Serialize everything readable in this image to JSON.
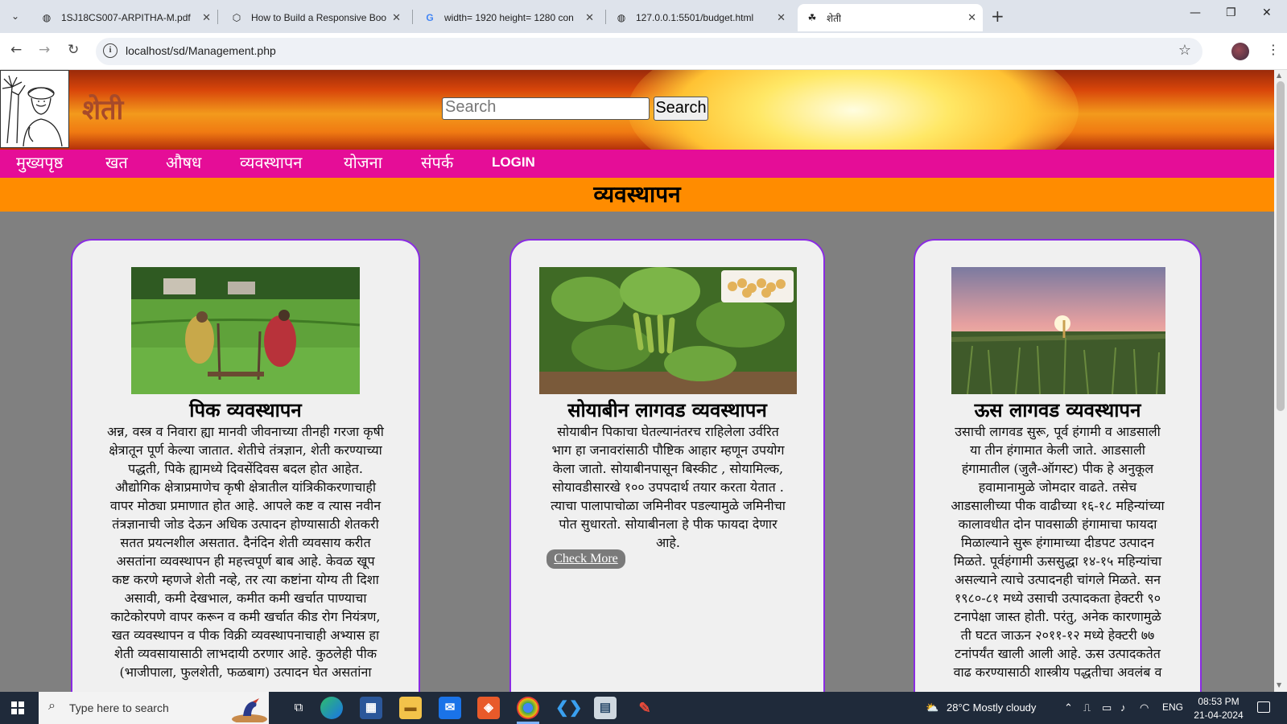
{
  "browser": {
    "tabs": [
      {
        "title": "1SJ18CS007-ARPITHA-M.pdf",
        "icon": "globe-icon"
      },
      {
        "title": "How to Build a Responsive Boo",
        "icon": "codepen-icon"
      },
      {
        "title": "width= 1920 height= 1280 con",
        "icon": "google-icon"
      },
      {
        "title": "127.0.0.1:5501/budget.html",
        "icon": "globe-icon"
      },
      {
        "title": "शेती",
        "icon": "farmer-favicon"
      }
    ],
    "url": "localhost/sd/Management.php"
  },
  "site": {
    "title": "शेती",
    "search_placeholder": "Search",
    "search_button": "Search",
    "nav": [
      "मुख्यपृष्ठ",
      "खत",
      "औषध",
      "व्यवस्थापन",
      "योजना",
      "संपर्क",
      "LOGIN"
    ],
    "section_heading": "व्यवस्थापन"
  },
  "cards": [
    {
      "title": "पिक व्यवस्थापन",
      "lines": [
        "अन्न, वस्त्र व निवारा ह्या मानवी जीवनाच्या तीनही गरजा कृषी",
        "क्षेत्रातून पूर्ण केल्या जातात. शेतीचे तंत्रज्ञान, शेती करण्याच्या",
        "पद्धती, पिके ह्यामध्ये दिवसेंदिवस बदल होत आहेत.",
        "औद्योगिक क्षेत्राप्रमाणेच कृषी क्षेत्रातील यांत्रिकीकरणाचाही",
        "वापर मोठ्या प्रमाणात होत आहे. आपले कष्ट व त्यास नवीन",
        "तंत्रज्ञानाची जोड देऊन अधिक उत्पादन होण्यासाठी शेतकरी",
        "सतत प्रयत्नशील असतात. दैनंदिन शेती व्यवसाय करीत",
        "असतांना व्यवस्थापन ही महत्त्वपूर्ण बाब आहे. केवळ खूप",
        "कष्ट करणे म्हणजे शेती नव्हे, तर त्या कष्टांना योग्य ती दिशा",
        "असावी, कमी देखभाल, कमीत कमी खर्चात पाण्याचा",
        "काटेकोरपणे वापर करून व कमी खर्चात कीड रोग नियंत्रण,",
        "खत व्यवस्थापन व पीक विक्री व्यवस्थापनाचाही अभ्यास हा",
        "शेती व्यवसायासाठी लाभदायी ठरणार आहे. कुठलेही पीक",
        "(भाजीपाला, फुलशेती, फळबाग) उत्पादन घेत असतांना"
      ]
    },
    {
      "title": "सोयाबीन लागवड व्यवस्थापन",
      "lines": [
        "सोयाबीन पिकाचा घेतल्यानंतरच राहिलेला उर्वरित",
        "भाग हा जनावरांसाठी पौष्टिक आहार म्हणून उपयोग",
        "केला जातो. सोयाबीनपासून बिस्कीट , सोयामिल्क,",
        "सोयावडीसारखे १०० उपपदार्थ तयार करता येतात .",
        "त्याचा पालापाचोळा जमिनीवर पडल्यामुळे जमिनीचा",
        "पोत सुधारतो. सोयाबीनला हे पीक फायदा देणार",
        "आहे."
      ],
      "button": "Check More"
    },
    {
      "title": "ऊस लागवड व्यवस्थापन",
      "lines": [
        "उसाची लागवड सुरू, पूर्व हंगामी व आडसाली",
        "या तीन हंगामात केली जाते. आडसाली",
        "हंगामातील (जुलै-ऑगस्ट) पीक हे अनुकूल",
        "हवामानामुळे जोमदार वाढते. तसेच",
        "आडसालीच्या पीक वाढीच्या १६-१८ महिन्यांच्या",
        "कालावधीत दोन पावसाळी हंगामाचा फायदा",
        "मिळाल्याने सुरू हंगामाच्या दीडपट उत्पादन",
        "मिळते. पूर्वहंगामी ऊससुद्धा १४-१५ महिन्यांचा",
        "असल्याने त्याचे उत्पादनही चांगले मिळते. सन",
        "१९८०-८१ मध्ये उसाची उत्पादकता हेक्टरी ९०",
        "टनापेक्षा जास्त होती. परंतु, अनेक कारणामुळे",
        "ती घटत जाऊन २०११-१२ मध्ये हेक्टरी ७७",
        "टनांपर्यंत खाली आली आहे. ऊस उत्पादकतेत",
        "वाढ करण्यासाठी शास्त्रीय पद्धतीचा अवलंब व"
      ]
    }
  ],
  "taskbar": {
    "search_placeholder": "Type here to search",
    "weather": "28°C  Mostly cloudy",
    "language": "ENG",
    "time": "08:53 PM",
    "date": "21-04-2024"
  }
}
